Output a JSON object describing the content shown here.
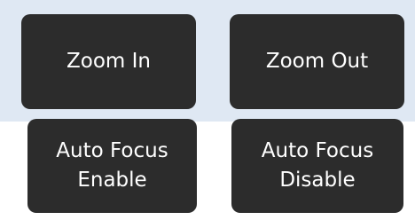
{
  "colors": {
    "panel_background": "#dfe8f3",
    "button_background": "#2c2c2c",
    "button_text": "#ffffff"
  },
  "buttons": {
    "zoom_in": {
      "label": "Zoom In"
    },
    "zoom_out": {
      "label": "Zoom Out"
    },
    "autofocus_enable": {
      "line1": "Auto Focus",
      "line2": "Enable"
    },
    "autofocus_disable": {
      "line1": "Auto Focus",
      "line2": "Disable"
    }
  }
}
